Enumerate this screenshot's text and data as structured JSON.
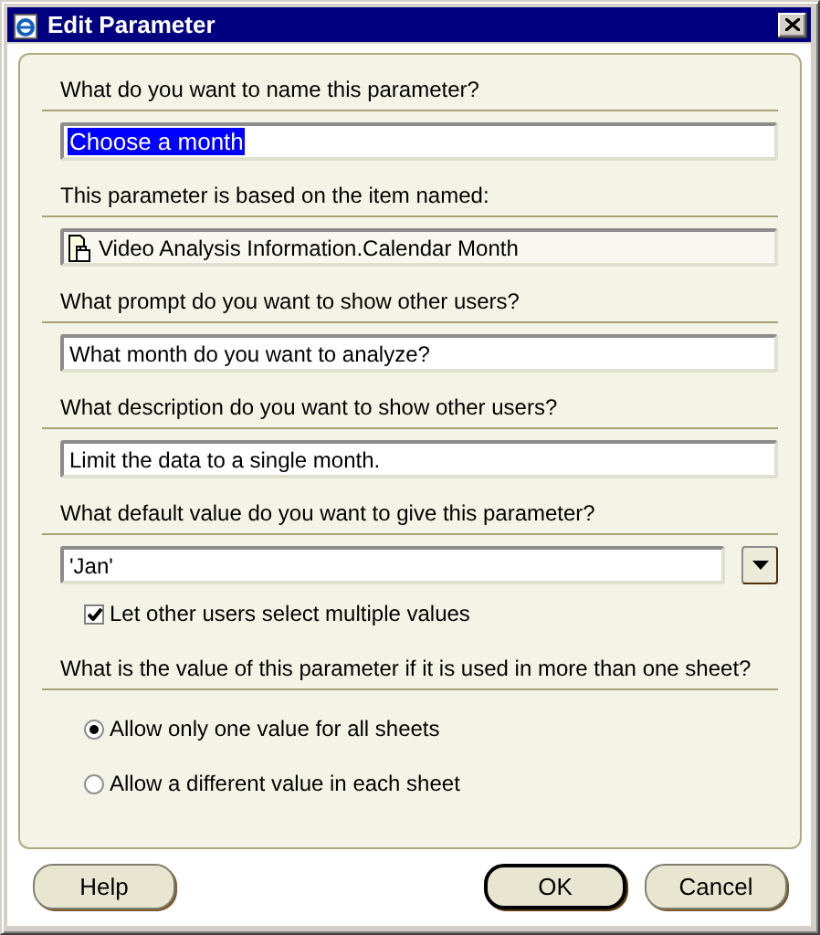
{
  "window": {
    "title": "Edit Parameter"
  },
  "sections": [
    {
      "kind": "text",
      "label": "What do you want to name this parameter?",
      "value": "Choose a month",
      "value_selected": true
    },
    {
      "kind": "item",
      "label": "This parameter is based on the item named:",
      "value": "Video Analysis Information.Calendar Month"
    },
    {
      "kind": "text",
      "label": "What prompt do you want to show other users?",
      "value": "What month do you want to analyze?",
      "value_selected": false
    },
    {
      "kind": "text",
      "label": "What description do you want to show other users?",
      "value": "Limit the data to a single month.",
      "value_selected": false
    },
    {
      "kind": "dropdown",
      "label": "What default value do you want to give this parameter?",
      "value": "'Jan'"
    }
  ],
  "multiple_values": {
    "label": "Let other users select multiple values",
    "checked": true
  },
  "scope": {
    "label": "What is the value of this parameter if it is used in more than one sheet?",
    "options": [
      {
        "label": "Allow only one value for all sheets",
        "selected": true
      },
      {
        "label": "Allow a different value in each sheet",
        "selected": false
      }
    ]
  },
  "buttons": [
    {
      "label": "Help",
      "default": false
    },
    {
      "label": "OK",
      "default": true
    },
    {
      "label": "Cancel",
      "default": false
    }
  ]
}
